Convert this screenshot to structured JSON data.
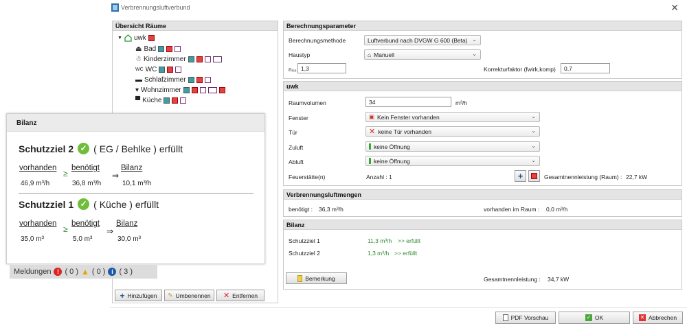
{
  "window": {
    "title": "Verbrennungsluftverbund"
  },
  "rooms_panel": {
    "header": "Übersicht Räume",
    "root": "uwk",
    "rooms": [
      "Bad",
      "Kinderzimmer",
      "WC",
      "Schlafzimmer",
      "Wohnzimmer",
      "Küche"
    ],
    "buttons": {
      "add": "Hinzufügen",
      "rename": "Umbenennen",
      "remove": "Entfernen"
    }
  },
  "calc_params": {
    "header": "Berechnungsparameter",
    "method_label": "Berechnungsmethode",
    "method_value": "Luftverbund nach DVGW G 600 (Beta)",
    "haustyp_label": "Haustyp",
    "haustyp_value": "Manuell",
    "n50_label": "n₅₀",
    "n50_value": "1,3",
    "korr_label": "Korrekturfaktor (fwirk,komp)",
    "korr_value": "0,7"
  },
  "room": {
    "header": "uwk",
    "raumvolumen_label": "Raumvolumen",
    "raumvolumen_value": "34",
    "raumvolumen_unit": "m³/h",
    "fenster_label": "Fenster",
    "fenster_value": "Kein Fenster vorhanden",
    "tuer_label": "Tür",
    "tuer_value": "keine Tür vorhanden",
    "zuluft_label": "Zuluft",
    "zuluft_value": "keine Öffnung",
    "abluft_label": "Abluft",
    "abluft_value": "keine Öffnung",
    "feuer_label": "Feuerstätte(n)",
    "feuer_count": "Anzahl : 1",
    "gesamt_raum": "Gesamtnennleistung (Raum) :",
    "gesamt_raum_value": "22,7 kW"
  },
  "luftmengen": {
    "header": "Verbrennungsluftmengen",
    "benoetigt_label": "benötigt :",
    "benoetigt_value": "36,3 m³/h",
    "vorhanden_label": "vorhanden im Raum :",
    "vorhanden_value": "0,0 m³/h"
  },
  "bilanz_panel": {
    "header": "Bilanz",
    "sz1_label": "Schutzziel 1",
    "sz1_value": "11,3 m³/h",
    "sz1_status": ">> erfüllt",
    "sz2_label": "Schutzziel 2",
    "sz2_value": "1,3 m³/h",
    "sz2_status": ">> erfüllt",
    "bemerkung": "Bemerkung",
    "gesamt_label": "Gesamtnennleistung :",
    "gesamt_value": "34,7 kW"
  },
  "bilanz_popup": {
    "header": "Bilanz",
    "sz2": {
      "title": "Schutzziel 2",
      "detail": "( EG / Behlke ) erfüllt",
      "h1": "vorhanden",
      "h2": "benötigt",
      "h3": "Bilanz",
      "v1": "46,9 m³/h",
      "v2": "36,8 m³/h",
      "v3": "10,1 m³/h"
    },
    "sz1": {
      "title": "Schutzziel 1",
      "detail": "( Küche ) erfüllt",
      "h1": "vorhanden",
      "h2": "benötigt",
      "h3": "Bilanz",
      "v1": "35,0 m³",
      "v2": "5,0 m³",
      "v3": "30,0 m³"
    },
    "ge": "≥",
    "arrow": "⇒"
  },
  "meldungen": {
    "label": "Meldungen",
    "errors": "( 0 )",
    "warnings": "( 0 )",
    "infos": "( 3 )"
  },
  "footer": {
    "pdf": "PDF Vorschau",
    "ok": "OK",
    "cancel": "Abbrechen"
  },
  "colors": {
    "success": "#2f8a2f",
    "check": "#6fbe3b",
    "panel_header": "#e4e4e4"
  }
}
